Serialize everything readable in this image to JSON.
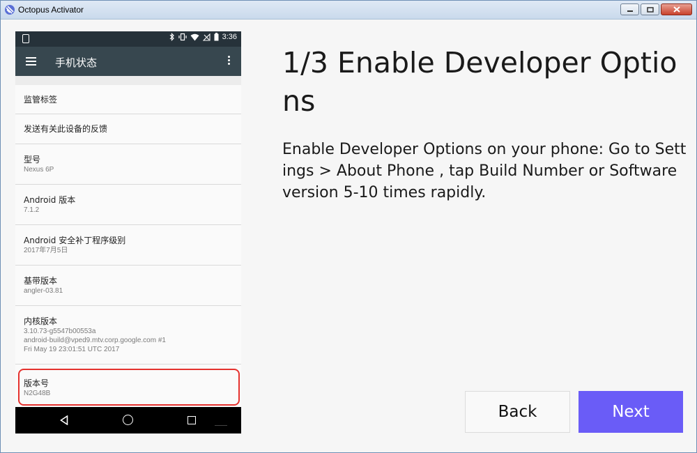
{
  "window": {
    "title": "Octopus Activator"
  },
  "phone": {
    "status_time": "3:36",
    "appbar_title": "手机状态",
    "rows": [
      {
        "title": "监管标签",
        "sub": []
      },
      {
        "title": "发送有关此设备的反馈",
        "sub": []
      },
      {
        "title": "型号",
        "sub": [
          "Nexus 6P"
        ]
      },
      {
        "title": "Android 版本",
        "sub": [
          "7.1.2"
        ]
      },
      {
        "title": "Android 安全补丁程序级别",
        "sub": [
          "2017年7月5日"
        ]
      },
      {
        "title": "基带版本",
        "sub": [
          "angler-03.81"
        ]
      },
      {
        "title": "内核版本",
        "sub": [
          "3.10.73-g5547b00553a",
          "android-build@vped9.mtv.corp.google.com #1",
          "Fri May 19 23:01:51 UTC 2017"
        ]
      },
      {
        "title": "版本号",
        "sub": [
          "N2G48B"
        ]
      }
    ],
    "highlight_color": "#e5322e"
  },
  "content": {
    "heading": "1/3 Enable Developer Options",
    "description": "Enable Developer Options on your phone: Go to Settings > About Phone , tap Build Number or Software version 5-10 times rapidly."
  },
  "buttons": {
    "back_label": "Back",
    "next_label": "Next",
    "next_color": "#6a5cf7"
  }
}
